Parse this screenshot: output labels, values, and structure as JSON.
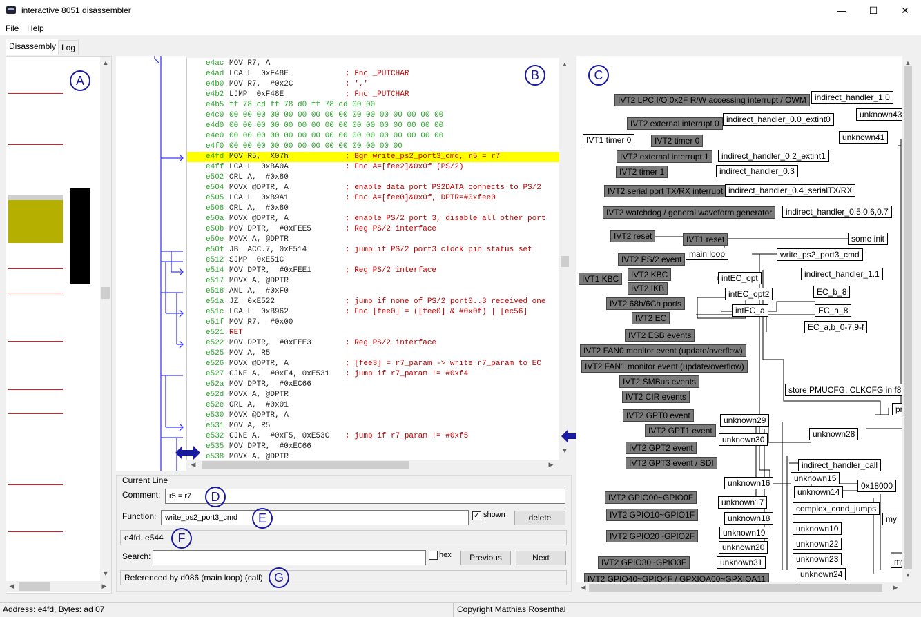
{
  "window": {
    "title": "interactive 8051 disassembler",
    "minimize": "—",
    "maximize": "☐",
    "close": "✕"
  },
  "menu": {
    "file": "File",
    "help": "Help"
  },
  "tabs": {
    "disassembly": "Disassembly",
    "log": "Log"
  },
  "markers": {
    "a": "A",
    "b": "B",
    "c": "C",
    "d": "D",
    "e": "E",
    "f": "F",
    "g": "G"
  },
  "code": [
    {
      "addr": "e4ac",
      "ins": "MOV R7, A",
      "cmt": ""
    },
    {
      "addr": "e4ad",
      "ins": "LCALL  0xF48E",
      "cmt": "; Fnc _PUTCHAR"
    },
    {
      "addr": "e4b0",
      "ins": "MOV R7,  #0x2C",
      "cmt": "; ','"
    },
    {
      "addr": "e4b2",
      "ins": "LJMP  0xF48E",
      "cmt": "; Fnc _PUTCHAR"
    },
    {
      "addr": "e4b5",
      "data": "ff 78 cd ff 78 d0 ff 78 cd 00 00"
    },
    {
      "addr": "e4c0",
      "data": "00 00 00 00 00 00 00 00 00 00 00 00 00 00 00 00"
    },
    {
      "addr": "e4d0",
      "data": "00 00 00 00 00 00 00 00 00 00 00 00 00 00 00 00"
    },
    {
      "addr": "e4e0",
      "data": "00 00 00 00 00 00 00 00 00 00 00 00 00 00 00 00"
    },
    {
      "addr": "e4f0",
      "data": "00 00 00 00 00 00 00 00 00 00 00 00 00"
    },
    {
      "addr": "e4fd",
      "ins": "MOV R5,  X07h",
      "cmt": "; Bgn write_ps2_port3_cmd, r5 = r7",
      "hl": true
    },
    {
      "addr": "e4ff",
      "ins": "LCALL  0xBA0A",
      "cmt": "; Fnc A=[fee2]&0x0f (PS/2)"
    },
    {
      "addr": "e502",
      "ins": "ORL A,  #0x80",
      "cmt": ""
    },
    {
      "addr": "e504",
      "ins": "MOVX @DPTR, A",
      "cmt": "; enable data port PS2DATA connects to PS/2"
    },
    {
      "addr": "e505",
      "ins": "LCALL  0xB9A1",
      "cmt": "; Fnc A=[fee0]&0x0f, DPTR=#0xfee0"
    },
    {
      "addr": "e508",
      "ins": "ORL A,  #0x80",
      "cmt": ""
    },
    {
      "addr": "e50a",
      "ins": "MOVX @DPTR, A",
      "cmt": "; enable PS/2 port 3, disable all other port"
    },
    {
      "addr": "e50b",
      "ins": "MOV DPTR,  #0xFEE5",
      "cmt": "; Reg PS/2 interface"
    },
    {
      "addr": "e50e",
      "ins": "MOVX A, @DPTR",
      "cmt": ""
    },
    {
      "addr": "e50f",
      "ins": "JB  ACC.7, 0xE514",
      "cmt": "; jump if PS/2 port3 clock pin status set"
    },
    {
      "addr": "e512",
      "ins": "SJMP  0xE51C",
      "cmt": ""
    },
    {
      "addr": "e514",
      "ins": "MOV DPTR,  #0xFEE1",
      "cmt": "; Reg PS/2 interface"
    },
    {
      "addr": "e517",
      "ins": "MOVX A, @DPTR",
      "cmt": ""
    },
    {
      "addr": "e518",
      "ins": "ANL A,  #0xF0",
      "cmt": ""
    },
    {
      "addr": "e51a",
      "ins": "JZ  0xE522",
      "cmt": "; jump if none of PS/2 port0..3 received one"
    },
    {
      "addr": "e51c",
      "ins": "LCALL  0xB962",
      "cmt": "; Fnc [fee0] = ([fee0] & #0x0f) | [ec56]"
    },
    {
      "addr": "e51f",
      "ins": "MOV R7,  #0x00",
      "cmt": ""
    },
    {
      "addr": "e521",
      "ins": "RET",
      "cmt": "",
      "ret": true
    },
    {
      "addr": "e522",
      "ins": "MOV DPTR,  #0xFEE3",
      "cmt": "; Reg PS/2 interface"
    },
    {
      "addr": "e525",
      "ins": "MOV A, R5",
      "cmt": ""
    },
    {
      "addr": "e526",
      "ins": "MOVX @DPTR, A",
      "cmt": "; [fee3] = r7_param -> write r7_param to EC"
    },
    {
      "addr": "e527",
      "ins": "CJNE A,  #0xF4, 0xE531",
      "cmt": "; jump if r7_param != #0xf4"
    },
    {
      "addr": "e52a",
      "ins": "MOV DPTR,  #0xEC66",
      "cmt": ""
    },
    {
      "addr": "e52d",
      "ins": "MOVX A, @DPTR",
      "cmt": ""
    },
    {
      "addr": "e52e",
      "ins": "ORL A,  #0x01",
      "cmt": ""
    },
    {
      "addr": "e530",
      "ins": "MOVX @DPTR, A",
      "cmt": ""
    },
    {
      "addr": "e531",
      "ins": "MOV A, R5",
      "cmt": ""
    },
    {
      "addr": "e532",
      "ins": "CJNE A,  #0xF5, 0xE53C",
      "cmt": "; jump if r7_param != #0xf5"
    },
    {
      "addr": "e535",
      "ins": "MOV DPTR,  #0xEC66",
      "cmt": ""
    },
    {
      "addr": "e538",
      "ins": "MOVX A, @DPTR",
      "cmt": ""
    }
  ],
  "current_line": {
    "group_label": "Current Line",
    "comment_label": "Comment:",
    "comment_value": "r5 = r7",
    "function_label": "Function:",
    "function_value": "write_ps2_port3_cmd",
    "shown_label": "shown",
    "shown_checked": true,
    "delete_label": "delete",
    "range": "e4fd..e544",
    "search_label": "Search:",
    "search_value": "",
    "hex_label": "hex",
    "previous_label": "Previous",
    "next_label": "Next",
    "referenced": "Referenced by d086 (main loop) (call)"
  },
  "graph": {
    "dark_nodes": [
      "IVT2 LPC I/O 0x2F R/W accessing interrupt / OWM",
      "IVT2 external interrupt 0",
      "IVT2 timer 0",
      "IVT2 external interrupt 1",
      "IVT2 timer 1",
      "IVT2 serial port TX/RX interrupt",
      "IVT2 watchdog / general waveform generator",
      "IVT2 reset",
      "IVT1 reset",
      "IVT2 PS/2 event",
      "IVT2 KBC",
      "IVT1 KBC",
      "IVT2 IKB",
      "IVT2 68h/6Ch ports",
      "IVT2 EC",
      "IVT2 ESB events",
      "IVT2 FAN0 monitor event (update/overflow)",
      "IVT2 FAN1 monitor event (update/overflow)",
      "IVT2 SMBus events",
      "IVT2 CIR events",
      "IVT2 GPT0 event",
      "IVT2 GPT1 event",
      "IVT2 GPT2 event",
      "IVT2 GPT3 event / SDI",
      "IVT2 GPIO00~GPIO0F",
      "IVT2 GPIO10~GPIO1F",
      "IVT2 GPIO20~GPIO2F",
      "IVT2 GPIO30~GPIO3F",
      "IVT2 GPIO40~GPIO4F / GPXIOA00~GPXIOA11"
    ],
    "white_nodes": [
      "indirect_handler_1.0",
      "unknown43",
      "indirect_handler_0.0_extint0",
      "unknown41",
      "IVT1 timer 0",
      "indirect_handler_0.2_extint1",
      "indirect_handler_0.3",
      "indirect_handler_0.4_serialTX/RX",
      "indirect_handler_0.5,0.6,0.7",
      "some init",
      "main loop",
      "write_ps2_port3_cmd",
      "indirect_handler_1.1",
      "intEC_opt",
      "intEC_opt2",
      "EC_b_8",
      "intEC_a",
      "EC_a_8",
      "EC_a,b_0-7,9-f",
      "store PMUCFG, CLKCFG in f8",
      "pr",
      "unknown29",
      "unknown30",
      "unknown28",
      "indirect_handler_call",
      "unknown15",
      "unknown16",
      "unknown14",
      "0x18000",
      "unknown17",
      "complex_cond_jumps",
      "my",
      "unknown18",
      "unknown19",
      "unknown10",
      "unknown20",
      "unknown22",
      "unknown31",
      "unknown23",
      "my",
      "unknown24"
    ]
  },
  "status": {
    "left": "Address: e4fd, Bytes: ad 07",
    "right": "Copyright Matthias Rosenthal"
  },
  "colors": {
    "highlight": "#ffff00",
    "address": "#2aa52a",
    "comment": "#c00000",
    "marker": "#1a1aa0",
    "arrow": "#3a3aff",
    "node_dark": "#7a7a7a"
  }
}
